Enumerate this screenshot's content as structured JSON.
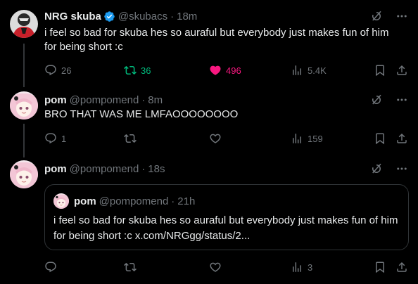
{
  "tweets": [
    {
      "name": "NRG skuba",
      "handle": "@skubacs",
      "time": "18m",
      "text": "i feel so bad for skuba hes so auraful but everybody just makes fun of him for being short :c",
      "replies": "26",
      "retweets": "36",
      "likes": "496",
      "views": "5.4K"
    },
    {
      "name": "pom",
      "handle": "@pompomend",
      "time": "8m",
      "text": "BRO THAT WAS ME LMFAOOOOOOOO",
      "replies": "1",
      "retweets": "",
      "likes": "",
      "views": "159"
    },
    {
      "name": "pom",
      "handle": "@pompomend",
      "time": "18s",
      "text": "",
      "replies": "",
      "retweets": "",
      "likes": "",
      "views": "3"
    }
  ],
  "quote": {
    "name": "pom",
    "handle": "@pompomend",
    "time": "21h",
    "text": "i feel so bad for skuba hes so auraful but everybody just makes fun of him for being short :c x.com/NRGgg/status/2..."
  },
  "colors": {
    "retweet_active": "#00ba7c",
    "like_active": "#f91880",
    "verified": "#1d9bf0",
    "muted": "#71767b"
  }
}
